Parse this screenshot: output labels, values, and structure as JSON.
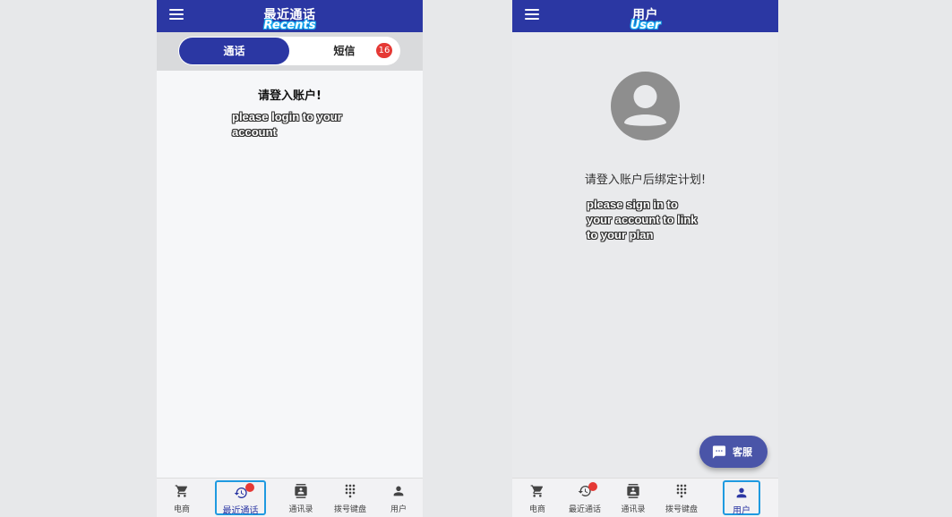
{
  "recents_screen": {
    "title": "最近通话",
    "subtitle": "Recents",
    "tabs": [
      {
        "label": "通话",
        "active": true
      },
      {
        "label": "短信",
        "active": false,
        "badge": "16"
      }
    ],
    "message": "请登入账户!",
    "annotation_line1": "please login to your",
    "annotation_line2": "account"
  },
  "user_screen": {
    "title": "用户",
    "subtitle": "User",
    "message": "请登入账户后绑定计划!",
    "annotation_line1": "please sign in to",
    "annotation_line2": "your account to link",
    "annotation_line3": "to your plan",
    "fab_label": "客服"
  },
  "bottom_nav": [
    {
      "label": "电商",
      "icon": "cart-icon"
    },
    {
      "label": "最近通话",
      "icon": "history-icon"
    },
    {
      "label": "通讯录",
      "icon": "contacts-icon"
    },
    {
      "label": "拨号键盘",
      "icon": "dialpad-icon"
    },
    {
      "label": "用户",
      "icon": "person-icon"
    }
  ],
  "colors": {
    "primary": "#2b37a3",
    "badge": "#e53935",
    "highlight": "#1f9ae0"
  }
}
